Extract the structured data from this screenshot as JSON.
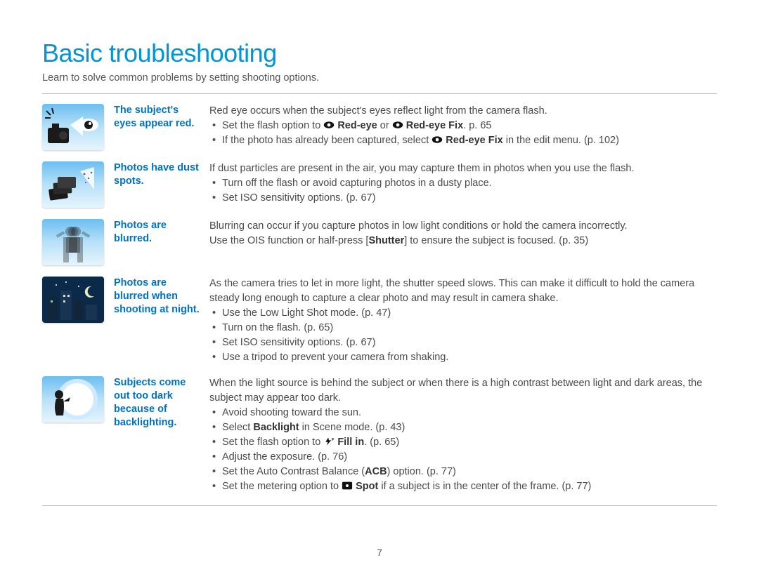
{
  "page": {
    "title": "Basic troubleshooting",
    "intro": "Learn to solve common problems by setting shooting options.",
    "number": "7"
  },
  "rows": [
    {
      "label": "The subject's eyes appear red.",
      "lead": "Red eye occurs when the subject's eyes reflect light from the camera flash.",
      "items": [
        {
          "pre": "Set the flash option to ",
          "icon": "eye-icon",
          "bold1": "Red-eye",
          "mid": " or ",
          "icon2": "eye-fix-icon",
          "bold2": "Red-eye Fix",
          "post": ". p. 65"
        },
        {
          "pre": "If the photo has already been captured, select ",
          "icon": "eye-fix-icon",
          "bold1": "Red-eye Fix",
          "post": " in the edit menu. (p. 102)"
        }
      ],
      "thumb": "redeye"
    },
    {
      "label": "Photos have dust spots.",
      "lead": "If dust particles are present in the air, you may capture them in photos when you use the flash.",
      "items": [
        {
          "pre": "Turn off the flash or avoid capturing photos in a dusty place."
        },
        {
          "pre": "Set ISO sensitivity options. (p. 67)"
        }
      ],
      "thumb": "dust"
    },
    {
      "label": "Photos are blurred.",
      "lead_parts": {
        "a": "Blurring can occur if you capture photos in low light conditions or hold the camera incorrectly.",
        "b": "Use the OIS function or half-press [",
        "bold": "Shutter",
        "c": "] to ensure the subject is focused. (p. 35)"
      },
      "thumb": "blur"
    },
    {
      "label": "Photos are blurred when shooting at night.",
      "lead": "As the camera tries to let in more light, the shutter speed slows. This can make it difficult to hold the camera steady long enough to capture a clear photo and may result in camera shake.",
      "items": [
        {
          "pre": "Use the Low Light Shot mode. (p. 47)"
        },
        {
          "pre": "Turn on the flash. (p. 65)"
        },
        {
          "pre": "Set ISO sensitivity options. (p. 67)"
        },
        {
          "pre": "Use a tripod to prevent your camera from shaking."
        }
      ],
      "thumb": "night"
    },
    {
      "label": "Subjects come out too dark because of backlighting.",
      "lead": "When the light source is behind the subject or when there is a high contrast between light and dark areas, the subject may appear too dark.",
      "items": [
        {
          "pre": "Avoid shooting toward the sun."
        },
        {
          "pre": "Select ",
          "bold1": "Backlight",
          "post": " in Scene mode. (p. 43)"
        },
        {
          "pre": "Set the flash option to ",
          "icon": "flash-fill-icon",
          "bold1": "Fill in",
          "post": ". (p. 65)"
        },
        {
          "pre": "Adjust the exposure. (p. 76)"
        },
        {
          "pre": "Set the Auto Contrast Balance (",
          "bold1": "ACB",
          "post": ") option. (p. 77)"
        },
        {
          "pre": "Set the metering option to ",
          "icon": "spot-icon",
          "bold1": "Spot",
          "post": " if a subject is in the center of the frame. (p. 77)"
        }
      ],
      "thumb": "backlight"
    }
  ]
}
